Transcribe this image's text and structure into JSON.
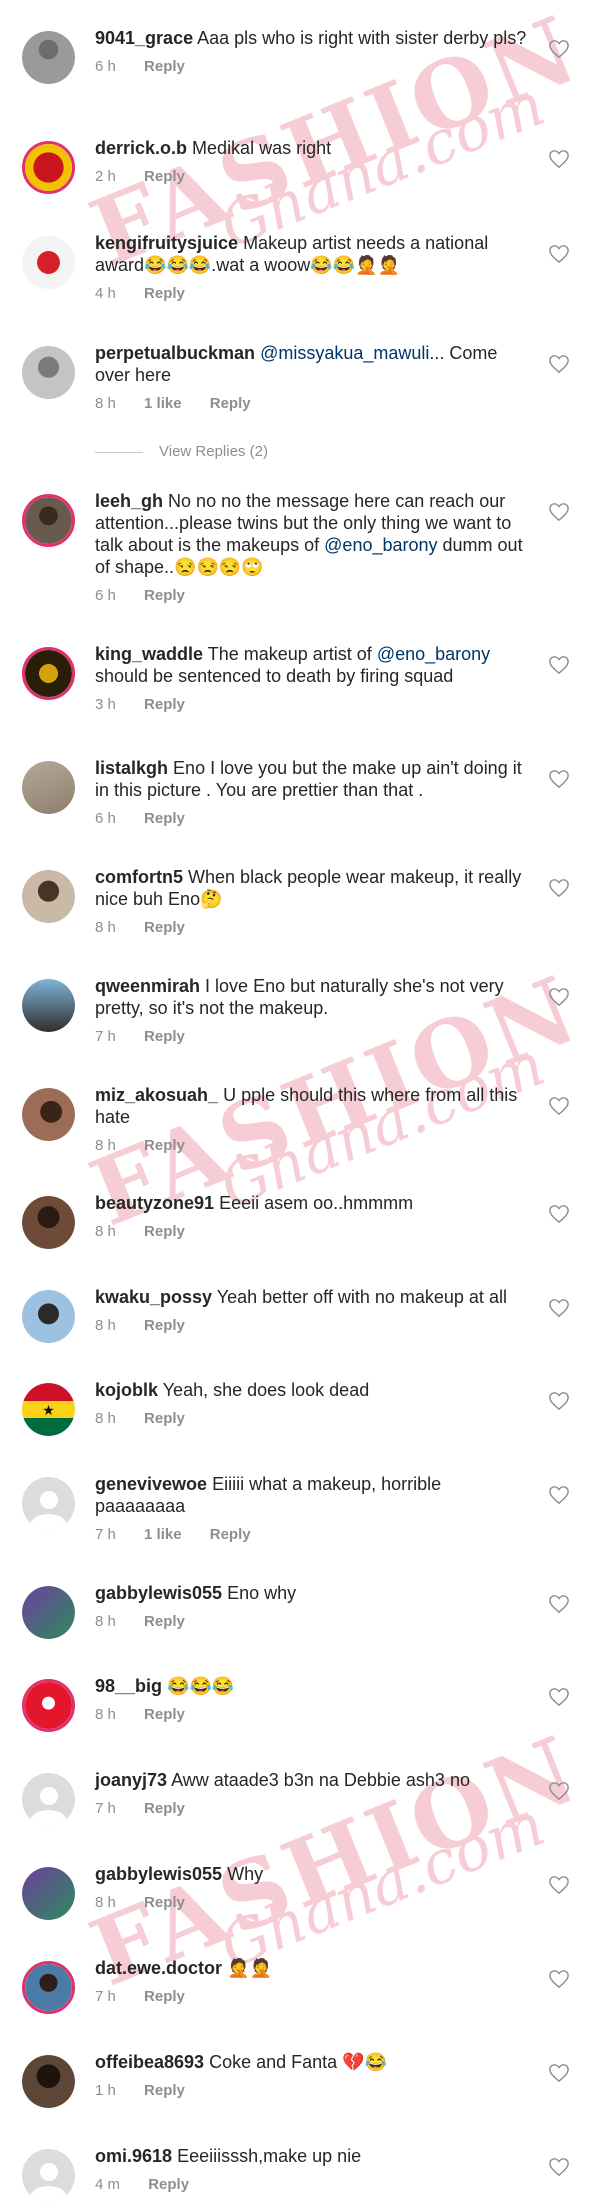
{
  "watermark": {
    "line1": "FASHION",
    "line2": "Ghana.com"
  },
  "colors": {
    "username": "#262626",
    "mention": "#003569",
    "meta": "#8e8e8e",
    "story_ring": "#e1306c"
  },
  "comments": [
    {
      "username": "9041_grace",
      "text": "Aaa pls who is right with sister derby pls?",
      "time": "6 h",
      "likes": "",
      "reply": "Reply",
      "avatar": "photo"
    },
    {
      "username": "derrick.o.b",
      "text": "Medikal was right",
      "time": "2 h",
      "likes": "",
      "reply": "Reply",
      "avatar": "story"
    },
    {
      "username": "kengifruitysjuice",
      "text": "Makeup artist needs a national award😂😂😂.wat a woow😂😂🤦🤦",
      "time": "4 h",
      "likes": "",
      "reply": "Reply",
      "avatar": "logo"
    },
    {
      "username": "perpetualbuckman",
      "mention": "@missyakua_mawuli",
      "text": "... Come over here",
      "time": "8 h",
      "likes": "1 like",
      "reply": "Reply",
      "avatar": "photo"
    },
    {
      "username": "leeh_gh",
      "text": "No no no the message here can reach our attention...please twins but the only thing we want to talk about is the makeups of",
      "mention": "@eno_barony",
      "text2": "dumm out of shape..😒😒😒🙄",
      "time": "6 h",
      "likes": "",
      "reply": "Reply",
      "avatar": "story"
    },
    {
      "username": "king_waddle",
      "text": "The makeup artist of",
      "mention": "@eno_barony",
      "text2": "should be sentenced to death by firing squad",
      "time": "3 h",
      "likes": "",
      "reply": "Reply",
      "avatar": "story"
    },
    {
      "username": "listalkgh",
      "text": "Eno I love you but the make up ain't doing it in this picture . You are prettier than that .",
      "time": "6 h",
      "likes": "",
      "reply": "Reply",
      "avatar": "photo"
    },
    {
      "username": "comfortn5",
      "text": "When black people wear makeup, it really nice buh Eno🤔",
      "time": "8 h",
      "likes": "",
      "reply": "Reply",
      "avatar": "photo"
    },
    {
      "username": "qweenmirah",
      "text": "I love Eno but naturally she's not very pretty, so it's not the makeup.",
      "time": "7 h",
      "likes": "",
      "reply": "Reply",
      "avatar": "photo"
    },
    {
      "username": "miz_akosuah_",
      "text": "U pple should  this where from all this hate",
      "time": "8 h",
      "likes": "",
      "reply": "Reply",
      "avatar": "photo"
    },
    {
      "username": "beautyzone91",
      "text": "Eeeii asem oo..hmmmm",
      "time": "8 h",
      "likes": "",
      "reply": "Reply",
      "avatar": "photo"
    },
    {
      "username": "kwaku_possy",
      "text": "Yeah better off with no makeup at all",
      "time": "8 h",
      "likes": "",
      "reply": "Reply",
      "avatar": "photo"
    },
    {
      "username": "kojoblk",
      "text": "Yeah, she does look dead",
      "time": "8 h",
      "likes": "",
      "reply": "Reply",
      "avatar": "flag"
    },
    {
      "username": "genevivewoe",
      "text": "Eiiiii what a makeup, horrible paaaaaaaa",
      "time": "7 h",
      "likes": "1 like",
      "reply": "Reply",
      "avatar": "placeholder"
    },
    {
      "username": "gabbylewis055",
      "text": "Eno why",
      "time": "8 h",
      "likes": "",
      "reply": "Reply",
      "avatar": "photo"
    },
    {
      "username": "98__big",
      "text": "😂😂😂",
      "time": "8 h",
      "likes": "",
      "reply": "Reply",
      "avatar": "story"
    },
    {
      "username": "joanyj73",
      "text": "Aww ataade3 b3n na Debbie ash3 no",
      "time": "7 h",
      "likes": "",
      "reply": "Reply",
      "avatar": "placeholder"
    },
    {
      "username": "gabbylewis055",
      "text": "Why",
      "time": "8 h",
      "likes": "",
      "reply": "Reply",
      "avatar": "photo"
    },
    {
      "username": "dat.ewe.doctor",
      "text": "🤦🤦",
      "time": "7 h",
      "likes": "",
      "reply": "Reply",
      "avatar": "story"
    },
    {
      "username": "offeibea8693",
      "text": "Coke and Fanta 💔😂",
      "time": "1 h",
      "likes": "",
      "reply": "Reply",
      "avatar": "photo"
    },
    {
      "username": "omi.9618",
      "text": "Eeeiiisssh,make up nie",
      "time": "4 m",
      "likes": "",
      "reply": "Reply",
      "avatar": "placeholder"
    }
  ],
  "view_replies": "View Replies (2)"
}
